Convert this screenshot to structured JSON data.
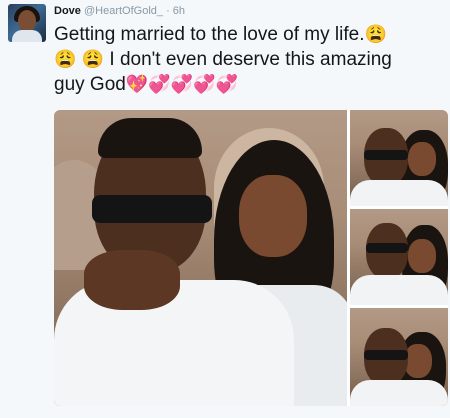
{
  "tweet": {
    "display_name": "Dove",
    "handle": "@HeartOfGold_",
    "separator": "·",
    "time": "6h",
    "text_line1": "Getting married to the love of my life.",
    "text_line2": "I don't even deserve this amazing",
    "text_line3": "guy God",
    "emoji": {
      "weary": "😩",
      "sparkling_heart": "💖",
      "revolving_hearts": "💞"
    }
  },
  "media": {
    "photo_count": 4,
    "icons": [
      "couple-photo-main",
      "couple-photo-thumb-1",
      "couple-photo-thumb-2",
      "couple-photo-thumb-3"
    ]
  },
  "colors": {
    "name": "#14171a",
    "meta": "#8899a6",
    "background": "#f5f8fa"
  }
}
